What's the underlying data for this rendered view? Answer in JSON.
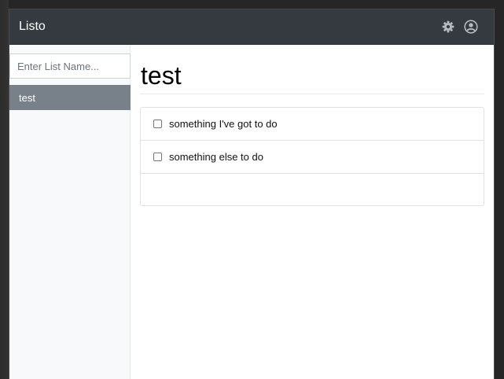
{
  "app": {
    "title": "Listo"
  },
  "navbar": {
    "settings_icon": "gear-icon",
    "account_icon": "user-circle-icon"
  },
  "sidebar": {
    "new_list_input": {
      "value": "",
      "placeholder": "Enter List Name..."
    },
    "lists": [
      {
        "label": "test",
        "active": true
      }
    ]
  },
  "main": {
    "title": "test",
    "todos": [
      {
        "text": "something I've got to do",
        "checked": false
      },
      {
        "text": "something else to do",
        "checked": false
      }
    ],
    "new_todo": {
      "value": ""
    }
  },
  "colors": {
    "navbar_bg": "#343a40",
    "active_item_bg": "#788189",
    "sidebar_bg": "#f8f9fa"
  }
}
